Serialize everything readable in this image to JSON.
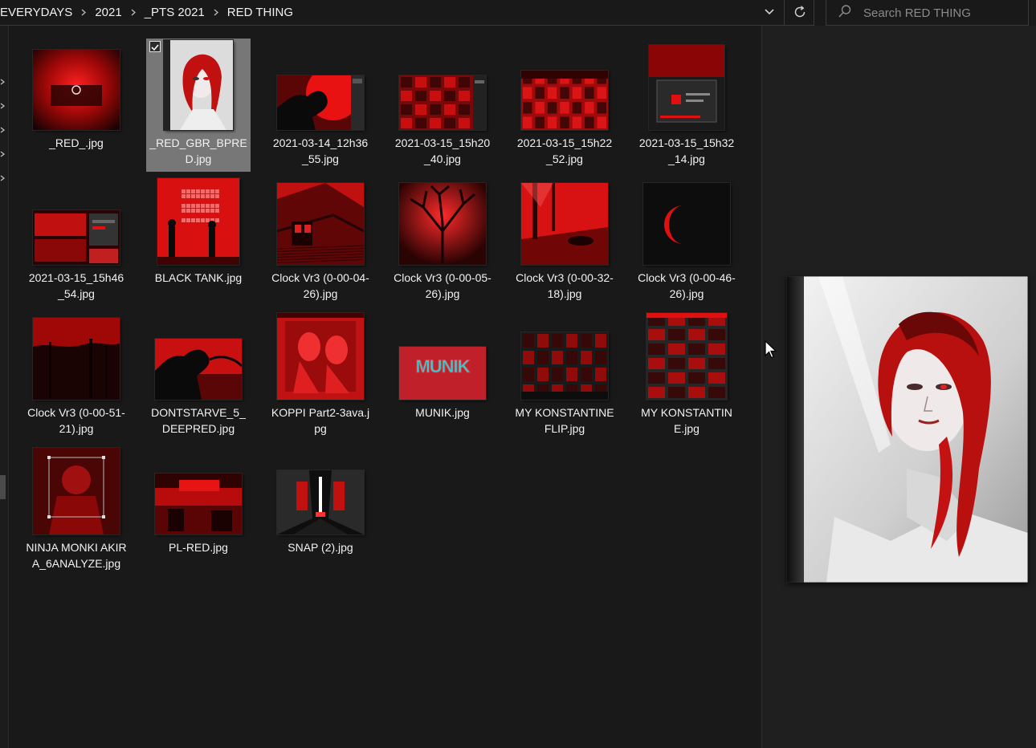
{
  "address_bar": {
    "breadcrumbs": [
      "EVERYDAYS",
      "2021",
      "_PTS 2021",
      "RED THING"
    ],
    "history_icon": "chevron-down-icon",
    "refresh_icon": "refresh-icon"
  },
  "search": {
    "placeholder": "Search RED THING",
    "value": "",
    "icon": "search-icon"
  },
  "files": [
    {
      "name": "_RED_.jpg",
      "selected": false,
      "w": 108,
      "h": 100
    },
    {
      "name": "_RED_GBR_BPRED.jpg",
      "selected": true,
      "checked": true,
      "w": 86,
      "h": 112
    },
    {
      "name": "2021-03-14_12h36_55.jpg",
      "selected": false,
      "w": 108,
      "h": 68
    },
    {
      "name": "2021-03-15_15h20_40.jpg",
      "selected": false,
      "w": 108,
      "h": 68
    },
    {
      "name": "2021-03-15_15h22_52.jpg",
      "selected": false,
      "w": 108,
      "h": 74
    },
    {
      "name": "2021-03-15_15h32_14.jpg",
      "selected": false,
      "w": 94,
      "h": 106
    },
    {
      "name": "2021-03-15_15h46_54.jpg",
      "selected": false,
      "w": 108,
      "h": 68
    },
    {
      "name": "BLACK TANK.jpg",
      "selected": false,
      "w": 102,
      "h": 108
    },
    {
      "name": "Clock Vr3 (0-00-04-26).jpg",
      "selected": false,
      "w": 108,
      "h": 102
    },
    {
      "name": "Clock Vr3 (0-00-05-26).jpg",
      "selected": false,
      "w": 108,
      "h": 102
    },
    {
      "name": "Clock Vr3 (0-00-32-18).jpg",
      "selected": false,
      "w": 108,
      "h": 102
    },
    {
      "name": "Clock Vr3 (0-00-46-26).jpg",
      "selected": false,
      "w": 108,
      "h": 102
    },
    {
      "name": "Clock Vr3 (0-00-51-21).jpg",
      "selected": false,
      "w": 108,
      "h": 102
    },
    {
      "name": "DONTSTARVE_5_DEEPRED.jpg",
      "selected": false,
      "w": 108,
      "h": 76
    },
    {
      "name": "KOPPI Part2-3ava.jpg",
      "selected": false,
      "w": 108,
      "h": 108
    },
    {
      "name": "MUNIK.jpg",
      "selected": false,
      "w": 108,
      "h": 66,
      "logo": "MUNIK"
    },
    {
      "name": "MY KONSTANTINE FLIP.jpg",
      "selected": false,
      "w": 108,
      "h": 84
    },
    {
      "name": "MY KONSTANTINE.jpg",
      "selected": false,
      "w": 100,
      "h": 108
    },
    {
      "name": "NINJA MONKI AKIRA_6ANALYZE.jpg",
      "selected": false,
      "w": 108,
      "h": 108
    },
    {
      "name": "PL-RED.jpg",
      "selected": false,
      "w": 108,
      "h": 76
    },
    {
      "name": "SNAP (2).jpg",
      "selected": false,
      "w": 108,
      "h": 80
    }
  ],
  "preview_pane": {
    "showing": "_RED_GBR_BPRED.jpg"
  },
  "colors": {
    "background": "#191919",
    "selected_tile": "#777777",
    "accent_red": "#e01010",
    "text": "#f2f2f2"
  }
}
